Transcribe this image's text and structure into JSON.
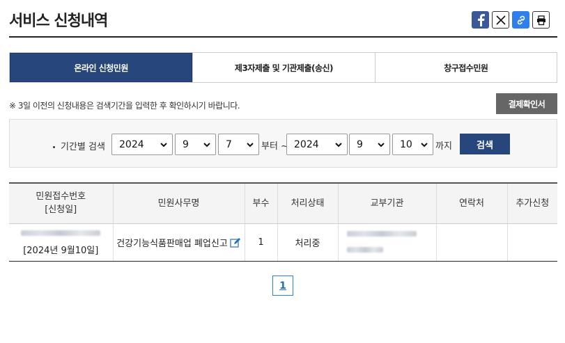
{
  "page": {
    "title": "서비스 신청내역"
  },
  "share": {
    "icons": [
      "facebook-icon",
      "x-icon",
      "link-icon",
      "print-icon"
    ]
  },
  "tabs": [
    {
      "label": "온라인 신청민원",
      "active": true
    },
    {
      "label": "제3자제출 및 기관제출(송신)",
      "active": false
    },
    {
      "label": "창구접수민원",
      "active": false
    }
  ],
  "notice": "※ 3일 이전의 신청내용은 검색기간을 입력한 후 확인하시기 바랍니다.",
  "confirm_button": "결제확인서",
  "search": {
    "label": "기간별 검색",
    "start": {
      "year": "2024",
      "month": "9",
      "day": "7"
    },
    "from_word": "부터 ~",
    "end": {
      "year": "2024",
      "month": "9",
      "day": "10"
    },
    "to_word": "까지",
    "button": "검색"
  },
  "table": {
    "headers": [
      "민원접수번호\n[신청일]",
      "민원사무명",
      "부수",
      "처리상태",
      "교부기관",
      "연락처",
      "추가신청"
    ],
    "rows": [
      {
        "date": "[2024년 9월10일]",
        "name": "건강기능식품판매업 폐업신고",
        "copies": "1",
        "status": "처리중",
        "contact": "",
        "additional": ""
      }
    ]
  },
  "pagination": {
    "current": "1"
  },
  "colors": {
    "primary": "#27477c",
    "confirm": "#666666"
  }
}
